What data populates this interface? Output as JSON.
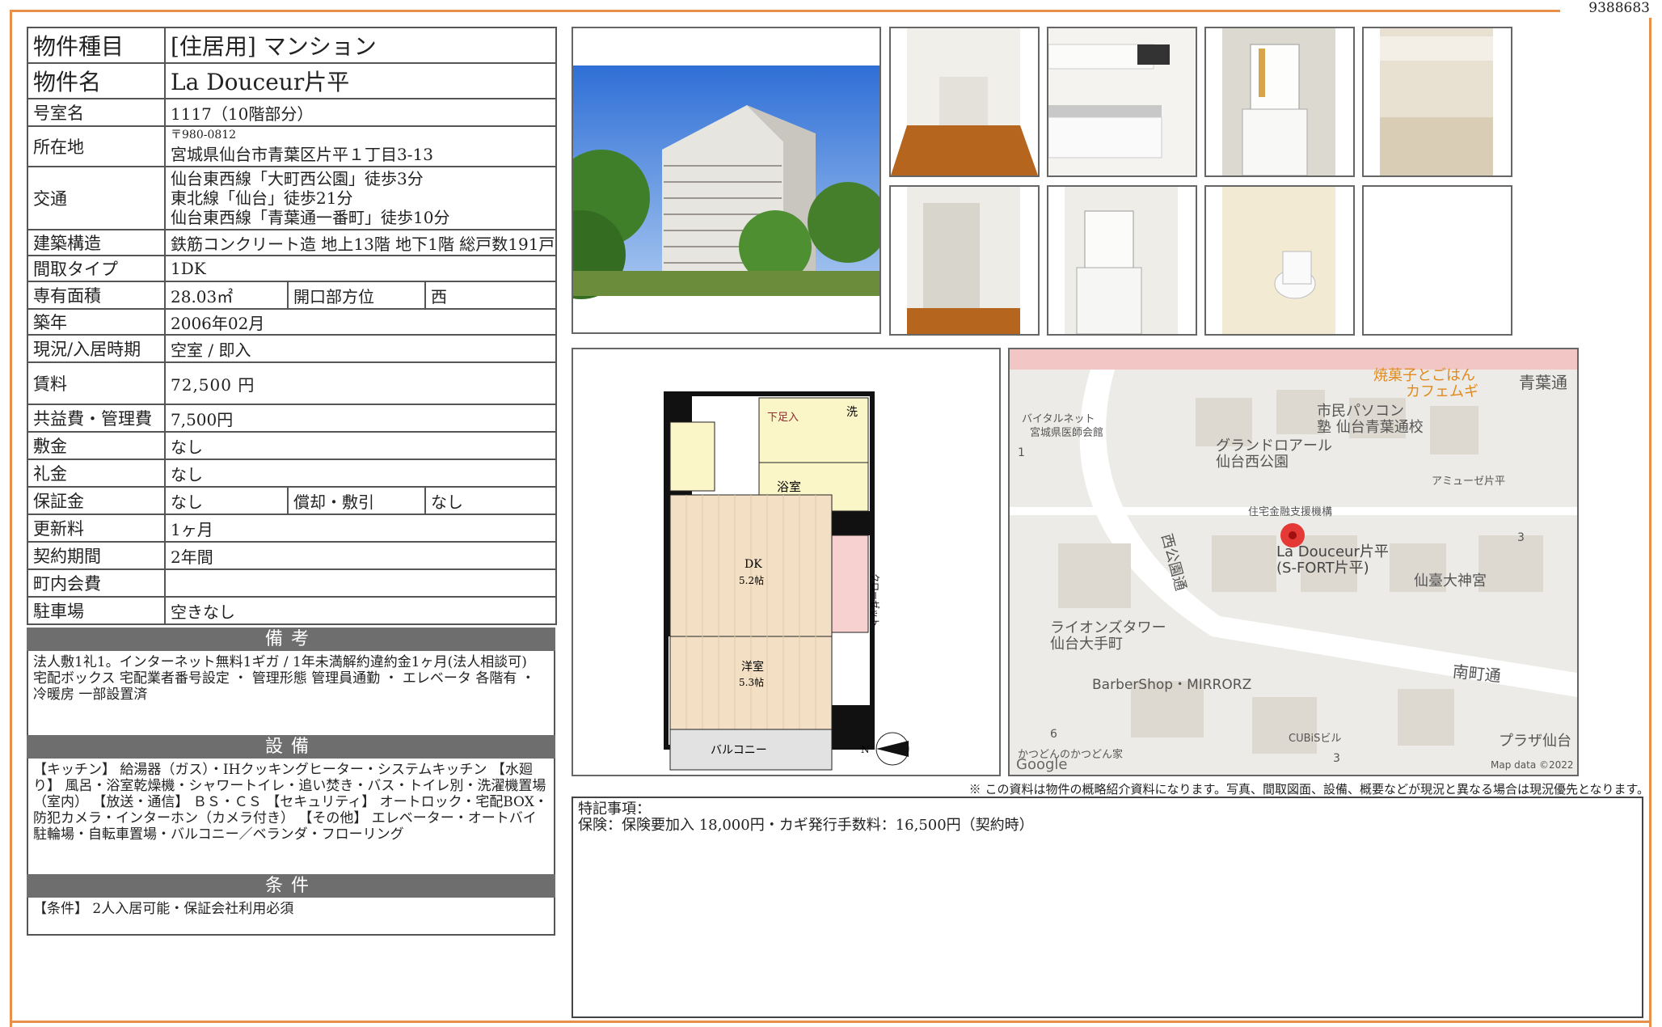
{
  "doc_id": "9388683",
  "property": {
    "type_label": "物件種目",
    "type_value": "[住居用] マンション",
    "name_label": "物件名",
    "name_value": "La Douceur片平",
    "room_label": "号室名",
    "room_value": "1117（10階部分）",
    "address_label": "所在地",
    "address_zip": "〒980-0812",
    "address_value": "宮城県仙台市青葉区片平１丁目3-13",
    "transport_label": "交通",
    "transport_lines": [
      "仙台東西線「大町西公園」徒歩3分",
      "東北線「仙台」徒歩21分",
      "仙台東西線「青葉通一番町」徒歩10分"
    ],
    "structure_label": "建築構造",
    "structure_value": "鉄筋コンクリート造 地上13階 地下1階 総戸数191戸",
    "layout_label": "間取タイプ",
    "layout_value": "1DK",
    "area_label": "専有面積",
    "area_value": "28.03㎡",
    "direction_label": "開口部方位",
    "direction_value": "西",
    "built_label": "築年",
    "built_value": "2006年02月",
    "status_label": "現況/入居時期",
    "status_value": "空室 / 即入",
    "rent_label": "賃料",
    "rent_value": "72,500 円",
    "fee_label": "共益費・管理費",
    "fee_value": "7,500円",
    "deposit_label": "敷金",
    "deposit_value": "なし",
    "key_money_label": "礼金",
    "key_money_value": "なし",
    "guarantee_label": "保証金",
    "guarantee_value": "なし",
    "amort_label": "償却・敷引",
    "amort_value": "なし",
    "renewal_label": "更新料",
    "renewal_value": "1ヶ月",
    "contract_label": "契約期間",
    "contract_value": "2年間",
    "community_label": "町内会費",
    "community_value": "",
    "parking_label": "駐車場",
    "parking_value": "空きなし"
  },
  "remarks": {
    "header": "備考",
    "text": "法人敷1礼1。インターネット無料1ギガ / 1年未満解約違約金1ヶ月(法人相談可)\n宅配ボックス 宅配業者番号設定 ・ 管理形態 管理員通勤 ・ エレベータ 各階有 ・ 冷暖房 一部設置済"
  },
  "equipment": {
    "header": "設備",
    "text": "【キッチン】 給湯器（ガス）・IHクッキングヒーター・システムキッチン 【水廻り】 風呂・浴室乾燥機・シャワートイレ・追い焚き・バス・トイレ別・洗濯機置場（室内） 【放送・通信】 ＢＳ・ＣＳ 【セキュリティ】 オートロック・宅配BOX・防犯カメラ・インターホン（カメラ付き） 【その他】 エレベーター・オートバイ駐輪場・自転車置場・バルコニー／ベランダ・フローリング"
  },
  "conditions": {
    "header": "条件",
    "text": "【条件】 2人入居可能・保証会社利用必須"
  },
  "floorplan": {
    "labels": [
      "下足入",
      "洗",
      "浴室",
      "DK",
      "5.2帖",
      "クローゼット",
      "洋室",
      "5.3帖",
      "バルコニー",
      "N"
    ]
  },
  "map": {
    "labels": [
      "焼菓子とごはん",
      "カフェムギ",
      "青葉通",
      "市民パソコン",
      "塾 仙台青葉通校",
      "バイタルネット",
      "宮城県医師会館",
      "グランドロアール",
      "仙台西公園",
      "アミューゼ片平",
      "住宅金融支援機構",
      "La Douceur片平",
      "(S-FORT片平)",
      "仙臺大神宮",
      "西公園通",
      "ライオンズタワー",
      "仙台大手町",
      "BarberShop・MIRRORZ",
      "南町通",
      "CUBiSビル",
      "プラザ仙台",
      "かつどんのかつどん家",
      "Google",
      "Map data ©2022",
      "1",
      "3",
      "3",
      "6"
    ]
  },
  "disclaimer": "※ この資料は物件の概略紹介資料になります。写真、間取図面、設備、概要などが現況と異なる場合は現況優先となります。",
  "notes": {
    "title": "特記事項：",
    "text": "保険：保険要加入 18,000円・カギ発行手数料：16,500円（契約時）"
  }
}
